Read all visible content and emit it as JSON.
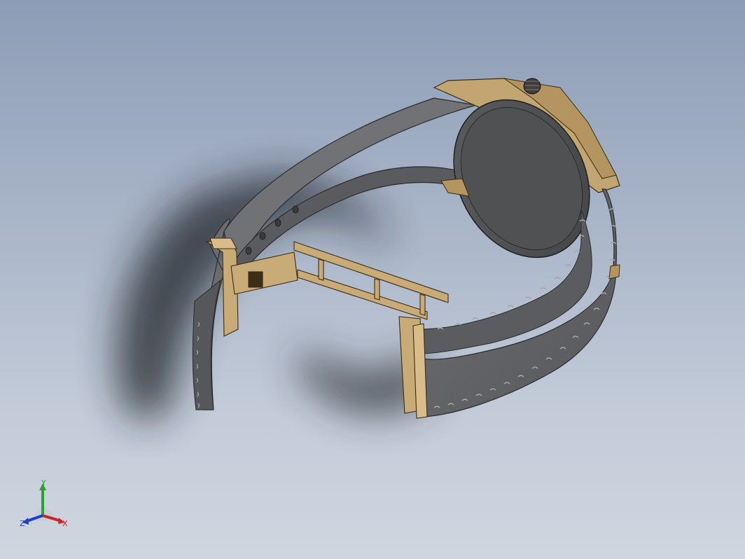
{
  "viewport": {
    "background_top": "#8d9db7",
    "background_bottom": "#cfd6e0"
  },
  "model": {
    "strap_color": "#5f6164",
    "metal_color": "#b89a66",
    "case_back_color": "#4e4f50"
  },
  "triad": {
    "y_label": "Y",
    "x_label": "X",
    "z_label": "Z",
    "x_color": "#d02020",
    "y_color": "#2ca02c",
    "z_color": "#1d3fd0"
  }
}
